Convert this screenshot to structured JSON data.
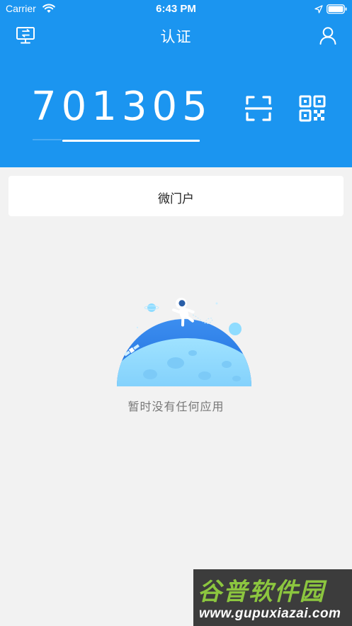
{
  "status_bar": {
    "carrier": "Carrier",
    "time": "6:43 PM"
  },
  "nav": {
    "title": "认证",
    "left_icon": "device-switch-icon",
    "right_icon": "user-icon"
  },
  "otp": {
    "code": "701305",
    "remaining_fraction": 0.82
  },
  "actions": {
    "scan_icon": "scan-icon",
    "qrcode_icon": "qrcode-icon"
  },
  "portal": {
    "label": "微门户"
  },
  "empty_state": {
    "message": "暂时没有任何应用"
  },
  "watermark": {
    "title": "谷普软件园",
    "url": "www.gupuxiazai.com"
  },
  "colors": {
    "primary": "#1b95f0",
    "background": "#f2f2f2",
    "watermark_green": "#8cc63f"
  }
}
